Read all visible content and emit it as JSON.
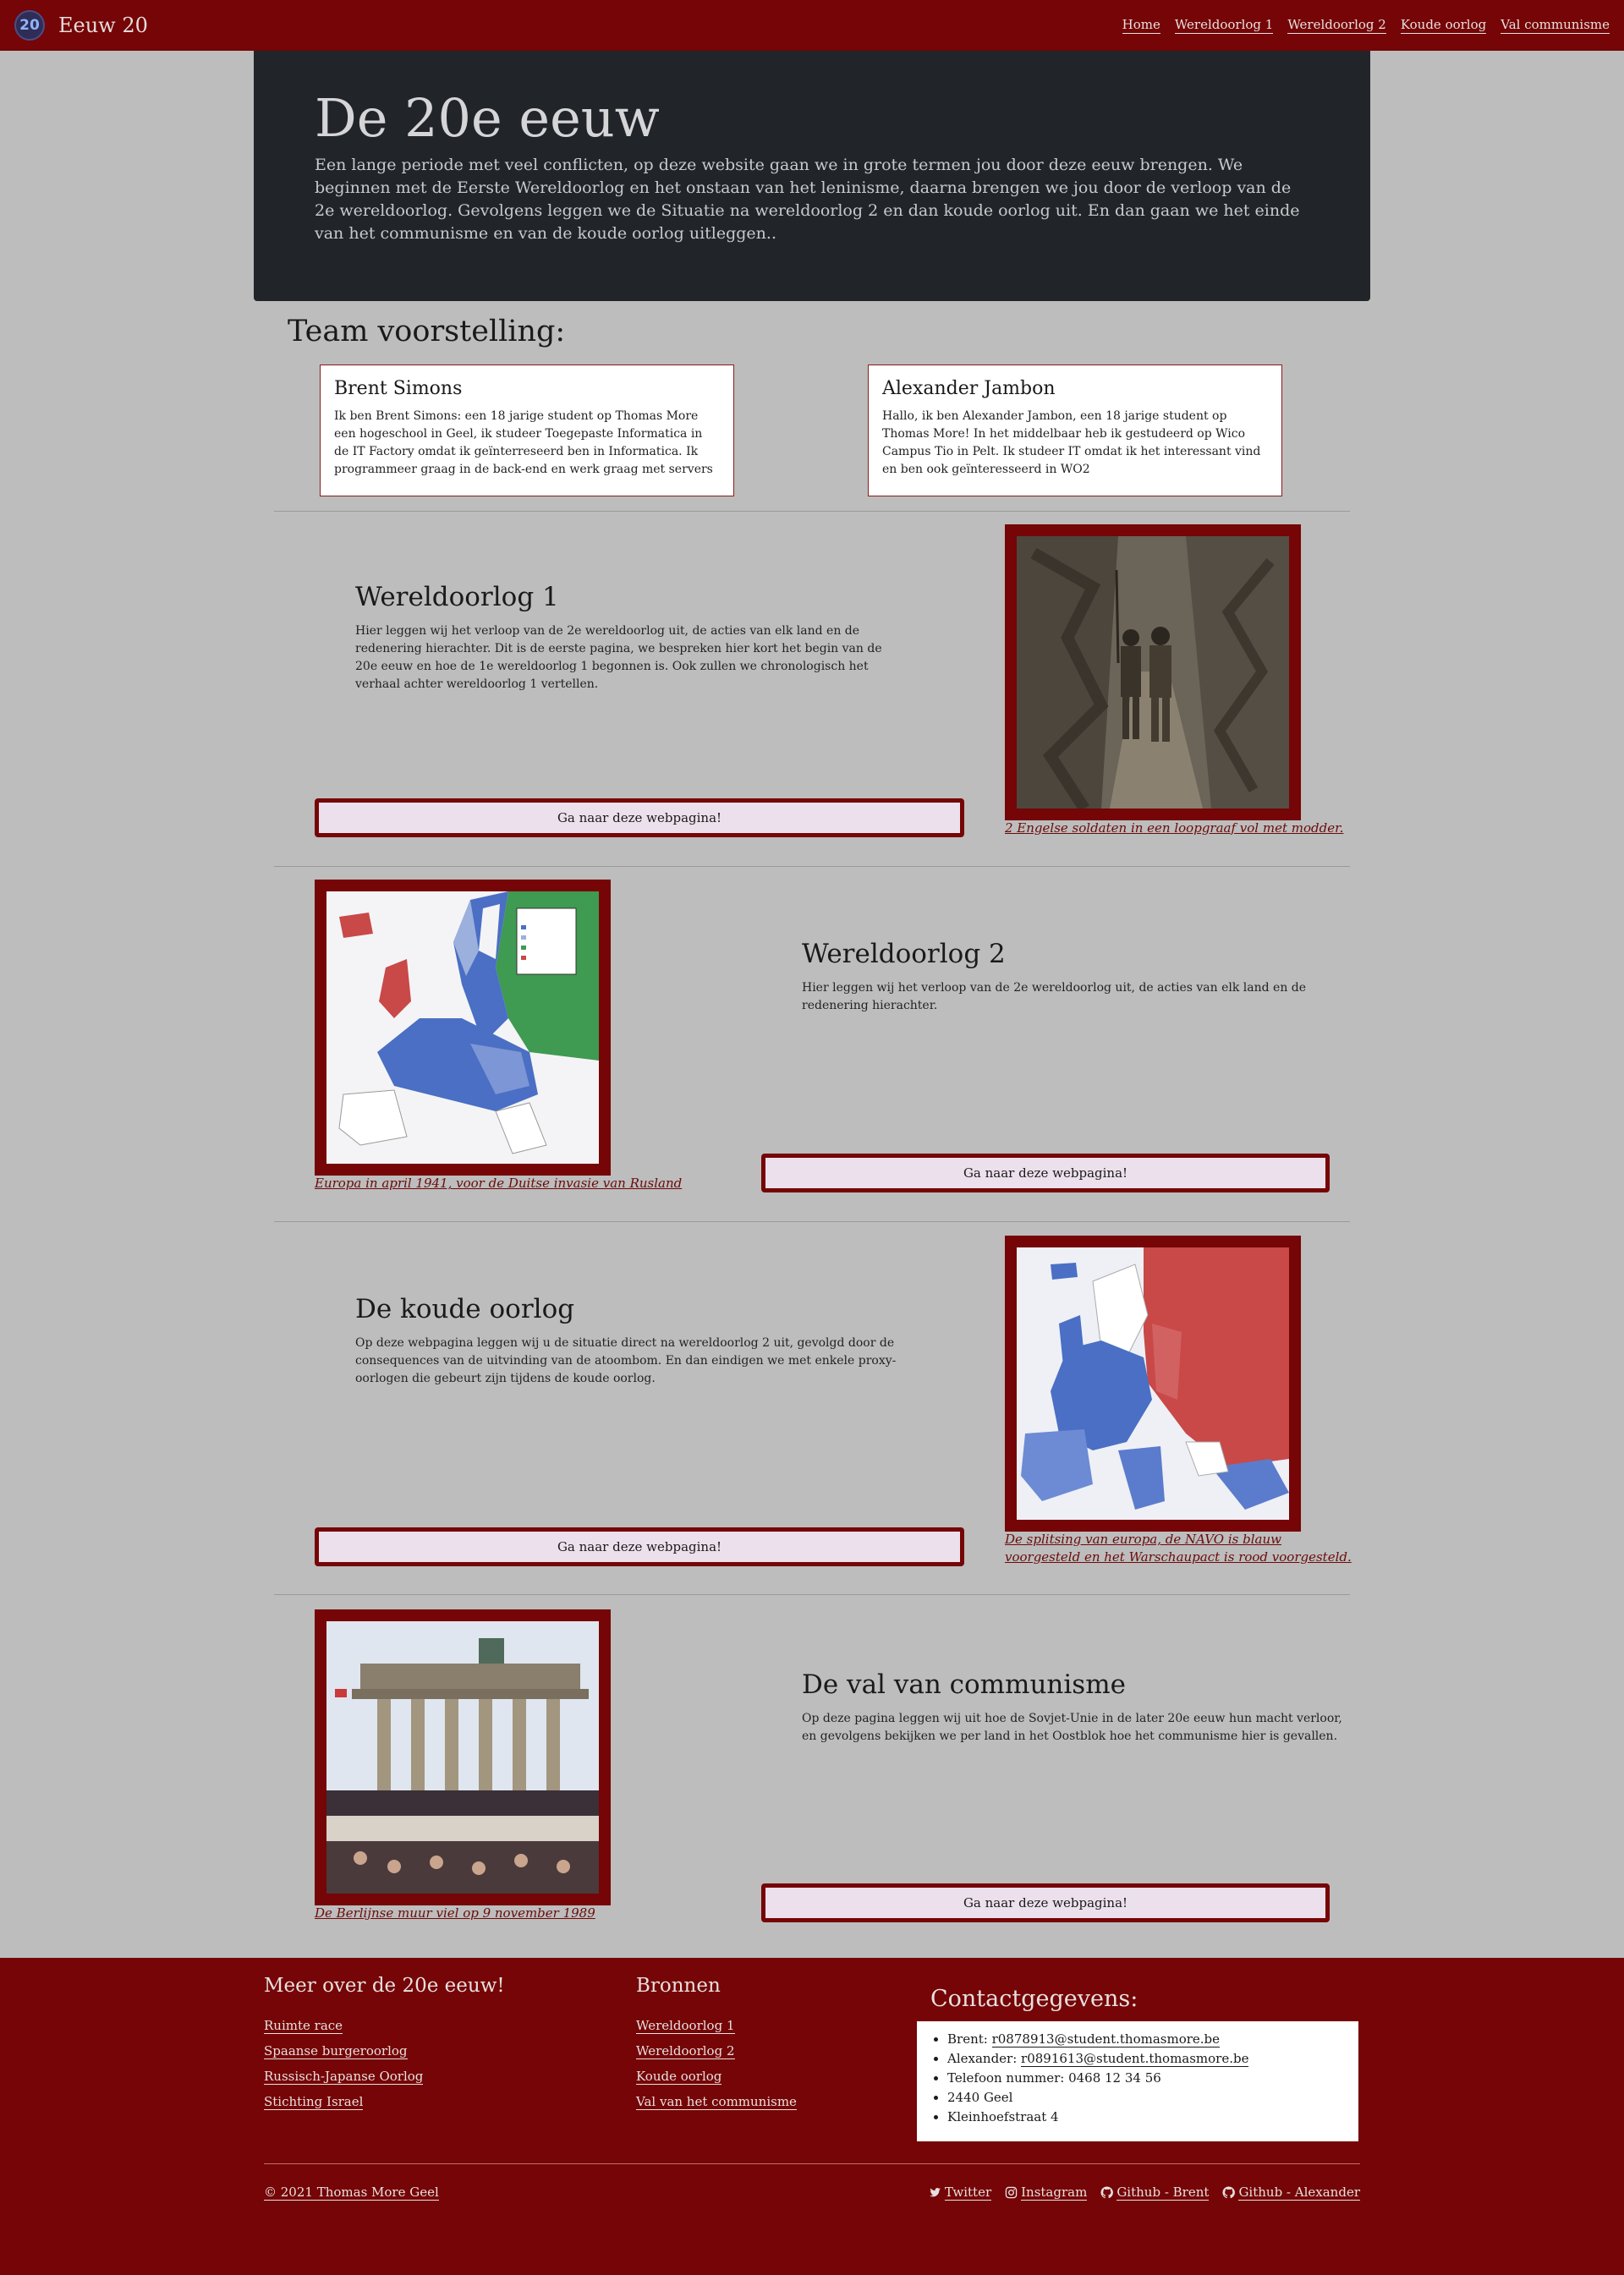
{
  "navbar": {
    "logo_text": "20",
    "brand": "Eeuw 20",
    "links": [
      "Home",
      "Wereldoorlog 1",
      "Wereldoorlog 2",
      "Koude oorlog",
      "Val communisme"
    ]
  },
  "hero": {
    "title": "De 20e eeuw",
    "text": "Een lange periode met veel conflicten, op deze website gaan we in grote termen jou door deze eeuw brengen. We beginnen met de Eerste Wereldoorlog en het onstaan van het leninisme, daarna brengen we jou door de verloop van de 2e wereldoorlog. Gevolgens leggen we de Situatie na wereldoorlog 2 en dan koude oorlog uit. En dan gaan we het einde van het communisme en van de koude oorlog uitleggen.."
  },
  "team": {
    "title": "Team voorstelling:",
    "members": [
      {
        "name": "Brent Simons",
        "bio": "Ik ben Brent Simons: een 18 jarige student op Thomas More een hogeschool in Geel, ik studeer Toegepaste Informatica in de IT Factory omdat ik geïnterreseerd ben in Informatica. Ik programmeer graag in de back-end en werk graag met servers"
      },
      {
        "name": "Alexander Jambon",
        "bio": "Hallo, ik ben Alexander Jambon, een 18 jarige student op Thomas More! In het middelbaar heb ik gestudeerd op Wico Campus Tio in Pelt. Ik studeer IT omdat ik het interessant vind en ben ook geïnteresseerd in WO2"
      }
    ]
  },
  "sections": [
    {
      "title": "Wereldoorlog 1",
      "text": "Hier leggen wij het verloop van de 2e wereldoorlog uit, de acties van elk land en de redenering hierachter. Dit is de eerste pagina, we bespreken hier kort het begin van de 20e eeuw en hoe de 1e wereldoorlog 1 begonnen is. Ook zullen we chronologisch het verhaal achter wereldoorlog 1 vertellen.",
      "button": "Ga naar deze webpagina!",
      "caption": "2 Engelse soldaten in een loopgraaf vol met modder.",
      "image": "trench-photo"
    },
    {
      "title": "Wereldoorlog 2",
      "text": "Hier leggen wij het verloop van de 2e wereldoorlog uit, de acties van elk land en de redenering hierachter.",
      "button": "Ga naar deze webpagina!",
      "caption": "Europa in april 1941, voor de Duitse invasie van Rusland",
      "image": "europe-1941-map"
    },
    {
      "title": "De koude oorlog",
      "text": "Op deze webpagina leggen wij u de situatie direct na wereldoorlog 2 uit, gevolgd door de consequences van de uitvinding van de atoombom. En dan eindigen we met enkele proxy-oorlogen die gebeurt zijn tijdens de koude oorlog.",
      "button": "Ga naar deze webpagina!",
      "caption": "De splitsing van europa, de NAVO is blauw voorgesteld en het Warschaupact is rood voorgesteld.",
      "image": "cold-war-map"
    },
    {
      "title": "De val van communisme",
      "text": "Op deze pagina leggen wij uit hoe de Sovjet-Unie in de later 20e eeuw hun macht verloor, en gevolgens bekijken we per land in het Oostblok hoe het communisme hier is gevallen.",
      "button": "Ga naar deze webpagina!",
      "caption": "De Berlijnse muur viel op 9 november 1989",
      "image": "berlin-wall-photo"
    }
  ],
  "footer": {
    "col1": {
      "title": "Meer over de 20e eeuw!",
      "links": [
        "Ruimte race",
        "Spaanse burgeroorlog",
        "Russisch-Japanse Oorlog",
        "Stichting Israel"
      ]
    },
    "col2": {
      "title": "Bronnen",
      "links": [
        "Wereldoorlog 1",
        "Wereldoorlog 2",
        "Koude oorlog",
        "Val van het communisme"
      ]
    },
    "contact": {
      "title": "Contactgegevens:",
      "brent_label": "Brent: ",
      "brent_email": "r0878913@student.thomasmore.be",
      "alex_label": "Alexander: ",
      "alex_email": "r0891613@student.thomasmore.be",
      "phone": "Telefoon nummer: 0468 12 34 56",
      "city": "2440 Geel",
      "street": "Kleinhoefstraat 4"
    },
    "copyright": "© 2021 Thomas More Geel",
    "socials": [
      "Twitter",
      "Instagram",
      "Github - Brent",
      "Github - Alexander"
    ]
  },
  "colors": {
    "brand": "#750506",
    "hero_bg": "#212529",
    "page_bg": "#bdbdbd",
    "button_bg": "#ece0ec"
  }
}
